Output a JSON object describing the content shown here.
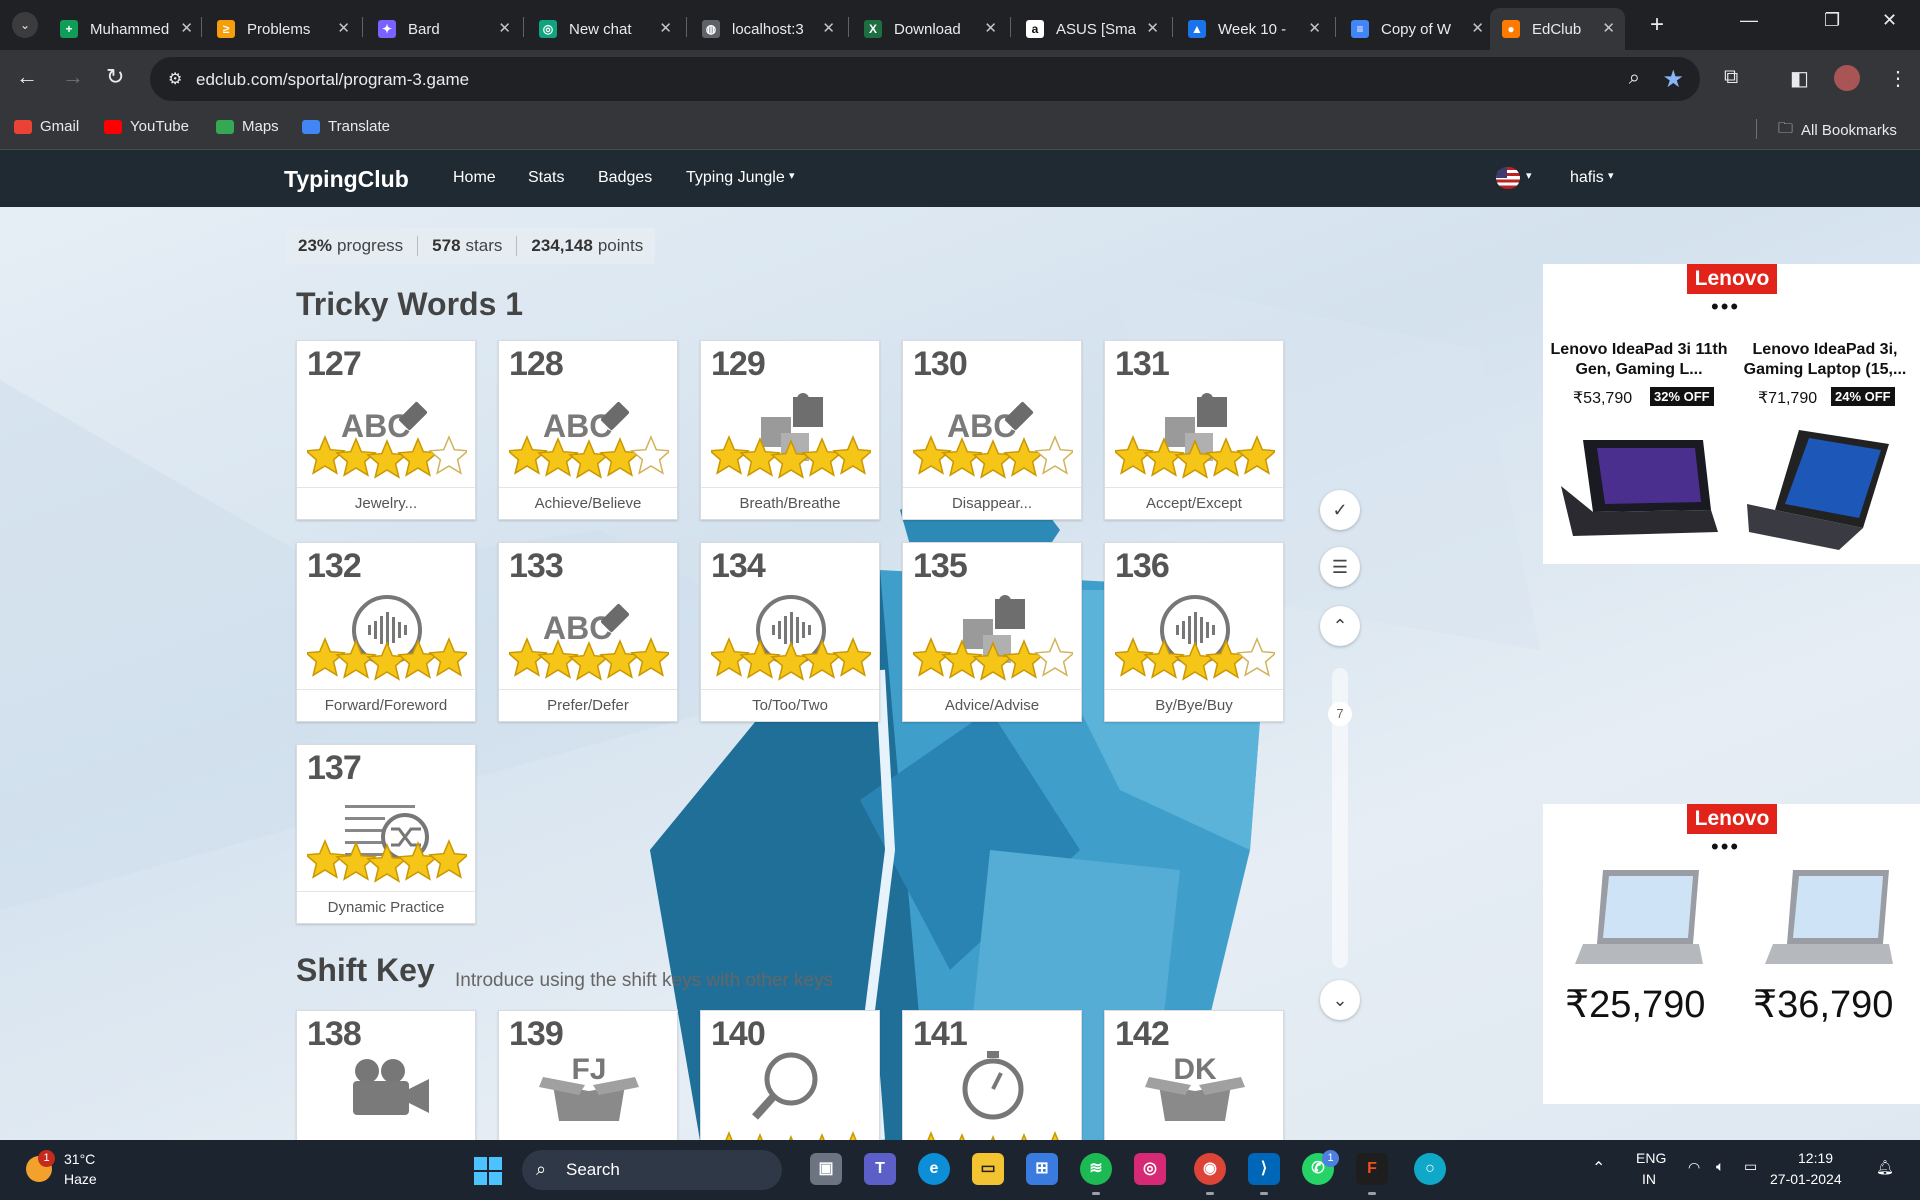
{
  "browser": {
    "tabs": [
      {
        "title": "Muhammed",
        "icon": "sheets-icon",
        "color": "#0f9d58",
        "glyph": "+"
      },
      {
        "title": "Problems",
        "icon": "problems-icon",
        "color": "#f59e0b",
        "glyph": "≥"
      },
      {
        "title": "Bard",
        "icon": "bard-icon",
        "color": "#7b61ff",
        "glyph": "✦"
      },
      {
        "title": "New chat",
        "icon": "chatgpt-icon",
        "color": "#10a37f",
        "glyph": "◎"
      },
      {
        "title": "localhost:3",
        "icon": "globe-icon",
        "color": "#5f6368",
        "glyph": "◍"
      },
      {
        "title": "Download",
        "icon": "excel-icon",
        "color": "#1d6f42",
        "glyph": "X"
      },
      {
        "title": "ASUS [Sma",
        "icon": "amazon-icon",
        "color": "#ffffff",
        "glyph": "a"
      },
      {
        "title": "Week 10 -",
        "icon": "drive-icon",
        "color": "#1a73e8",
        "glyph": "▲"
      },
      {
        "title": "Copy of W",
        "icon": "docs-icon",
        "color": "#4285f4",
        "glyph": "≡"
      },
      {
        "title": "EdClub",
        "icon": "edclub-icon",
        "color": "#ff7a00",
        "glyph": "●"
      }
    ],
    "url": "edclub.com/sportal/program-3.game",
    "bookmarks": [
      {
        "label": "Gmail",
        "icon": "gmail-icon",
        "color": "#ea4335"
      },
      {
        "label": "YouTube",
        "icon": "youtube-icon",
        "color": "#ff0000"
      },
      {
        "label": "Maps",
        "icon": "maps-icon",
        "color": "#34a853"
      },
      {
        "label": "Translate",
        "icon": "translate-icon",
        "color": "#4285f4"
      }
    ],
    "all_bookmarks": "All Bookmarks"
  },
  "site": {
    "brand": "TypingClub",
    "nav": [
      "Home",
      "Stats",
      "Badges",
      "Typing Jungle"
    ],
    "user": "hafis"
  },
  "progress": {
    "progress_value": "23%",
    "progress_label": "progress",
    "stars_value": "578",
    "stars_label": "stars",
    "points_value": "234,148",
    "points_label": "points"
  },
  "sections": [
    {
      "title": "Tricky Words 1",
      "subtitle": "",
      "lessons": [
        {
          "num": "127",
          "name": "Jewelry...",
          "icon": "abc-eraser-icon",
          "stars": 4
        },
        {
          "num": "128",
          "name": "Achieve/Believe",
          "icon": "abc-eraser-icon",
          "stars": 4
        },
        {
          "num": "129",
          "name": "Breath/Breathe",
          "icon": "puzzle-icon",
          "stars": 5
        },
        {
          "num": "130",
          "name": "Disappear...",
          "icon": "abc-eraser-icon",
          "stars": 4
        },
        {
          "num": "131",
          "name": "Accept/Except",
          "icon": "puzzle-icon",
          "stars": 5
        },
        {
          "num": "132",
          "name": "Forward/Foreword",
          "icon": "audio-icon",
          "stars": 5
        },
        {
          "num": "133",
          "name": "Prefer/Defer",
          "icon": "abc-eraser-icon",
          "stars": 5
        },
        {
          "num": "134",
          "name": "To/Too/Two",
          "icon": "audio-icon",
          "stars": 5
        },
        {
          "num": "135",
          "name": "Advice/Advise",
          "icon": "puzzle-icon",
          "stars": 4
        },
        {
          "num": "136",
          "name": "By/Bye/Buy",
          "icon": "audio-icon",
          "stars": 4
        },
        {
          "num": "137",
          "name": "Dynamic Practice",
          "icon": "shuffle-lines-icon",
          "stars": 5
        }
      ]
    },
    {
      "title": "Shift Key",
      "subtitle": "Introduce using the shift keys with other keys",
      "lessons": [
        {
          "num": "138",
          "name": "",
          "icon": "video-camera-icon",
          "glyph": "",
          "stars": 0
        },
        {
          "num": "139",
          "name": "",
          "icon": "box-icon",
          "glyph": "FJ",
          "stars": 0
        },
        {
          "num": "140",
          "name": "",
          "icon": "magnifier-icon",
          "glyph": "",
          "stars": 5
        },
        {
          "num": "141",
          "name": "",
          "icon": "stopwatch-icon",
          "glyph": "",
          "stars": 5
        },
        {
          "num": "142",
          "name": "",
          "icon": "box-icon",
          "glyph": "DK",
          "stars": 0
        }
      ]
    }
  ],
  "side_tools": {
    "scroll_index": "7"
  },
  "ads": [
    {
      "brand": "Lenovo",
      "products": [
        {
          "name": "Lenovo IdeaPad 3i 11th Gen, Gaming L...",
          "price": "₹53,790",
          "discount": "32% OFF"
        },
        {
          "name": "Lenovo IdeaPad 3i, Gaming Laptop (15,...",
          "price": "₹71,790",
          "discount": "24% OFF"
        }
      ]
    },
    {
      "brand": "Lenovo",
      "products": [
        {
          "price": "₹25,790"
        },
        {
          "price": "₹36,790"
        }
      ]
    }
  ],
  "taskbar": {
    "temperature": "31°C",
    "condition": "Haze",
    "weather_badge": "1",
    "search_label": "Search",
    "whatsapp_badge": "1",
    "lang_top": "ENG",
    "lang_bottom": "IN",
    "time": "12:19",
    "date": "27-01-2024"
  }
}
